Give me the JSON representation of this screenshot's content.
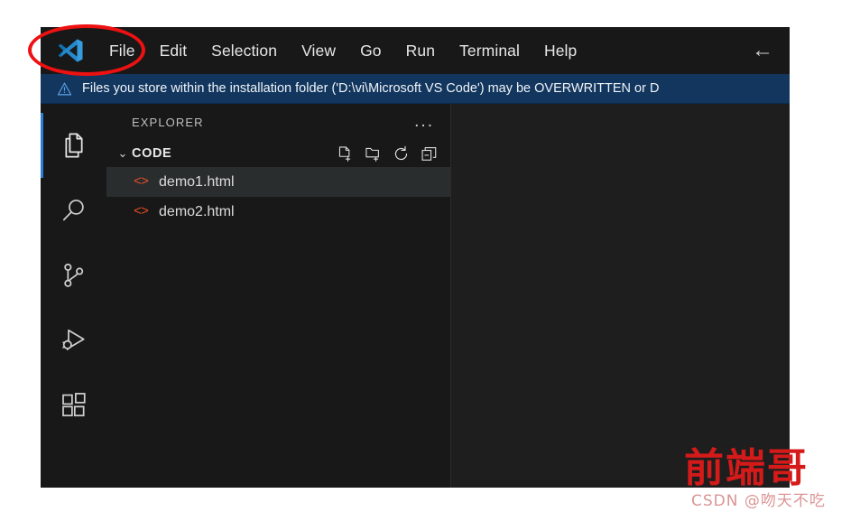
{
  "window": {
    "app_name": "Visual Studio Code",
    "logo_icon": "vscode-logo-icon"
  },
  "menu_bar": {
    "items": [
      {
        "label": "File",
        "name": "menu-item-file"
      },
      {
        "label": "Edit",
        "name": "menu-item-edit"
      },
      {
        "label": "Selection",
        "name": "menu-item-selection"
      },
      {
        "label": "View",
        "name": "menu-item-view"
      },
      {
        "label": "Go",
        "name": "menu-item-go"
      },
      {
        "label": "Run",
        "name": "menu-item-run"
      },
      {
        "label": "Terminal",
        "name": "menu-item-terminal"
      },
      {
        "label": "Help",
        "name": "menu-item-help"
      }
    ],
    "back_arrow": "←",
    "back_arrow_icon": "arrow-left-icon"
  },
  "notification": {
    "icon": "warning-triangle-icon",
    "text": "Files you store within the installation folder ('D:\\vi\\Microsoft VS Code') may be OVERWRITTEN or D",
    "background_color": "#13365e"
  },
  "activity_bar": {
    "items": [
      {
        "name": "activity-item-explorer",
        "icon": "files-icon",
        "label": "Explorer",
        "active": true
      },
      {
        "name": "activity-item-search",
        "icon": "search-icon",
        "label": "Search",
        "active": false
      },
      {
        "name": "activity-item-source-control",
        "icon": "source-control-branch-icon",
        "label": "Source Control",
        "active": false
      },
      {
        "name": "activity-item-run-debug",
        "icon": "run-and-debug-icon",
        "label": "Run and Debug",
        "active": false
      },
      {
        "name": "activity-item-extensions",
        "icon": "extensions-icon",
        "label": "Extensions",
        "active": false
      }
    ],
    "active_indicator_color": "#2a7fd4"
  },
  "sidebar": {
    "title": "EXPLORER",
    "more_actions_icon": "ellipsis-icon",
    "more_actions_label": "...",
    "folder": {
      "name": "CODE",
      "expanded": true,
      "chevron": "⌄",
      "actions": [
        {
          "name": "new-file-button",
          "icon": "new-file-icon",
          "label": "New File"
        },
        {
          "name": "new-folder-button",
          "icon": "new-folder-icon",
          "label": "New Folder"
        },
        {
          "name": "refresh-explorer-button",
          "icon": "refresh-icon",
          "label": "Refresh Explorer"
        },
        {
          "name": "collapse-folders-button",
          "icon": "collapse-all-icon",
          "label": "Collapse Folders in Explorer"
        }
      ]
    },
    "files": [
      {
        "name": "demo1.html",
        "icon": "html-file-icon",
        "selected": true
      },
      {
        "name": "demo2.html",
        "icon": "html-file-icon",
        "selected": false
      }
    ]
  },
  "editor": {
    "empty": true,
    "background_color": "#1e1e1e"
  },
  "annotation": {
    "shape": "ellipse",
    "color": "#ee1111",
    "target": "vscode-logo-and-file-menu"
  },
  "watermarks": {
    "main": "前端哥",
    "main_color": "#d51a1a",
    "sub": "CSDN @吻天不吃"
  }
}
